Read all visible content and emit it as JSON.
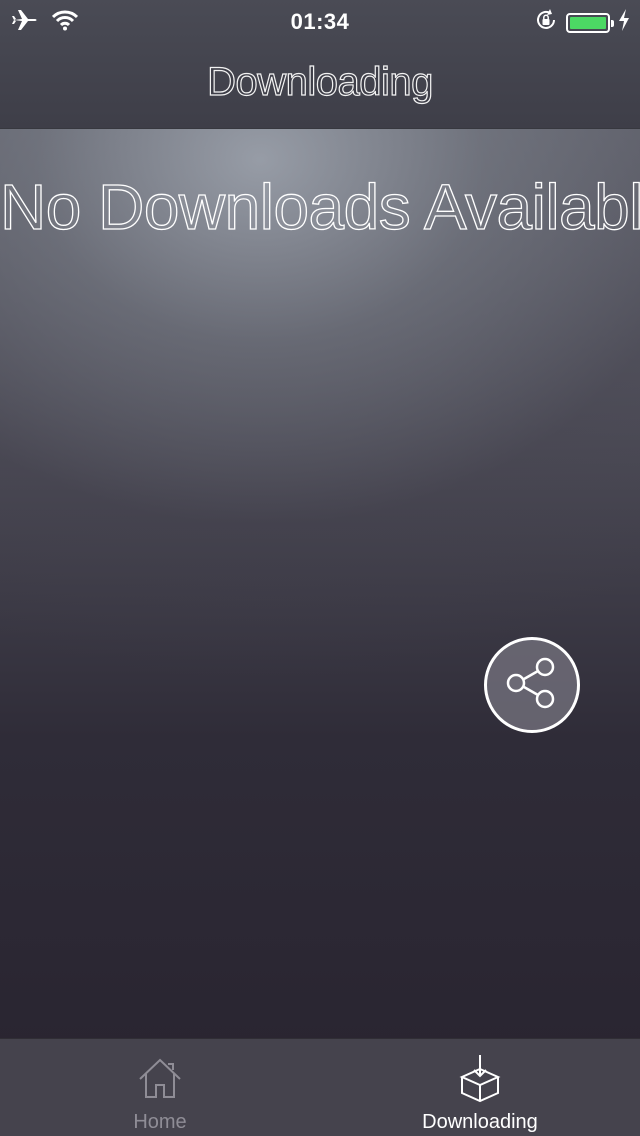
{
  "status_bar": {
    "time": "01:34",
    "icons": [
      "airplane-icon",
      "wifi-icon",
      "rotation-lock-icon",
      "battery-icon",
      "charging-bolt-icon"
    ],
    "battery_color": "#4cd964"
  },
  "nav": {
    "title": "Downloading"
  },
  "main": {
    "empty_message": "No Downloads Available",
    "share_icon": "share-icon"
  },
  "tabs": [
    {
      "label": "Home",
      "icon": "house-icon",
      "selected": false
    },
    {
      "label": "Downloading",
      "icon": "download-box-icon",
      "selected": true
    }
  ],
  "colors": {
    "tab_inactive": "#8f8d96",
    "tab_active": "#ffffff"
  }
}
